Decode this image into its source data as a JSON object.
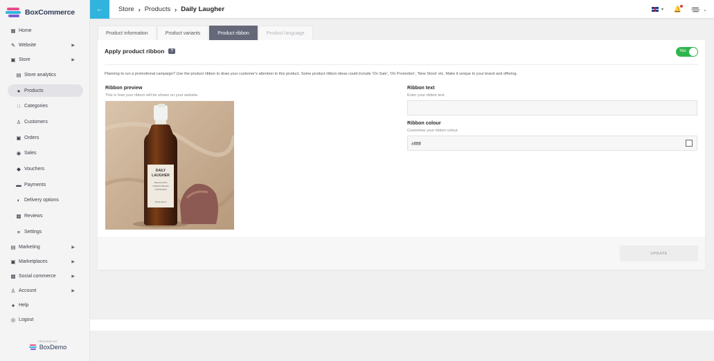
{
  "brand": {
    "name": "BoxCommerce"
  },
  "sidebar": {
    "items": [
      {
        "label": "Home",
        "icon": "grid-icon",
        "chevron": false
      },
      {
        "label": "Website",
        "icon": "brush-icon",
        "chevron": true
      },
      {
        "label": "Store",
        "icon": "bag-icon",
        "chevron": true
      },
      {
        "label": "Store analytics",
        "icon": "chart-icon",
        "sub": true
      },
      {
        "label": "Products",
        "icon": "tag-icon",
        "sub": true,
        "active": true
      },
      {
        "label": "Categories",
        "icon": "categories-icon",
        "sub": true
      },
      {
        "label": "Customers",
        "icon": "people-icon",
        "sub": true
      },
      {
        "label": "Orders",
        "icon": "bag-icon",
        "sub": true
      },
      {
        "label": "Sales",
        "icon": "sales-icon",
        "sub": true
      },
      {
        "label": "Vouchers",
        "icon": "voucher-icon",
        "sub": true
      },
      {
        "label": "Payments",
        "icon": "card-icon",
        "sub": true
      },
      {
        "label": "Delivery options",
        "icon": "truck-icon",
        "sub": true
      },
      {
        "label": "Reviews",
        "icon": "reviews-icon",
        "sub": true
      },
      {
        "label": "Settings",
        "icon": "sliders-icon",
        "sub": true
      },
      {
        "label": "Marketing",
        "icon": "marketing-icon",
        "chevron": true
      },
      {
        "label": "Marketplaces",
        "icon": "store-icon",
        "chevron": true
      },
      {
        "label": "Social commerce",
        "icon": "social-icon",
        "chevron": true
      },
      {
        "label": "Account",
        "icon": "user-icon",
        "chevron": true
      },
      {
        "label": "Help",
        "icon": "help-icon",
        "chevron": false
      },
      {
        "label": "Logout",
        "icon": "logout-icon",
        "chevron": false
      }
    ],
    "provided_by": "PROVIDED BY",
    "provider": "BoxDemo"
  },
  "header": {
    "breadcrumb": [
      "Store",
      "Products",
      "Daily Laugher"
    ]
  },
  "tabs": [
    {
      "label": "Product information",
      "state": "normal"
    },
    {
      "label": "Product variants",
      "state": "normal"
    },
    {
      "label": "Product ribbon",
      "state": "active"
    },
    {
      "label": "Product language",
      "state": "disabled"
    }
  ],
  "ribbon": {
    "title": "Apply product ribbon",
    "help_badge": "?",
    "toggle_label": "Yes",
    "toggle_on": true,
    "description": "Planning to run a promotional campaign? Use the product ribbon to draw your customer's attention to this product. Some product ribbon ideas could include 'On Sale', 'On Promotion', 'New Stock' etc. Make it unique to your brand and offering.",
    "preview_title": "Ribbon preview",
    "preview_sub": "This is how your ribbon will be shown on your website.",
    "product_label": {
      "line1": "DAILY",
      "line2": "LAUGHER",
      "line3": "RELAXATION",
      "line4": "STRESS RELIEF",
      "line5": "HAPPINESS",
      "line6": "TAKE DAILY"
    },
    "text_title": "Ribbon text",
    "text_sub": "Enter your ribbon text.",
    "text_value": "",
    "colour_title": "Ribbon colour",
    "colour_sub": "Customise your ribbon colour.",
    "colour_value": "#ffffff",
    "update_label": "UPDATE"
  },
  "colors": {
    "accent": "#30b4dd",
    "toggle_on": "#2eb64c",
    "active_tab": "#646879"
  }
}
